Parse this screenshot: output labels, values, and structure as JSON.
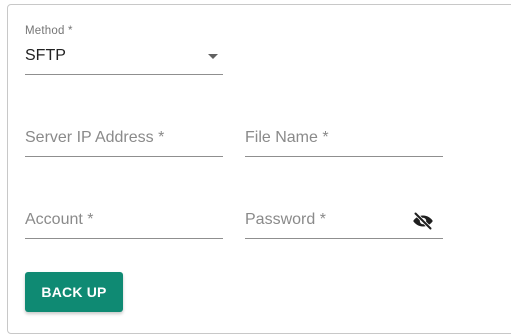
{
  "method": {
    "label": "Method *",
    "value": "SFTP"
  },
  "server_ip": {
    "placeholder": "Server IP Address *",
    "value": ""
  },
  "file_name": {
    "placeholder": "File Name *",
    "value": ""
  },
  "account": {
    "placeholder": "Account *",
    "value": ""
  },
  "password": {
    "placeholder": "Password *",
    "value": "",
    "visibility_icon": "eye-off-icon"
  },
  "actions": {
    "backup_label": "BACK UP"
  },
  "colors": {
    "primary_button": "#0f8a73",
    "border": "#c8c8c8",
    "underline": "#8f8f8f"
  }
}
